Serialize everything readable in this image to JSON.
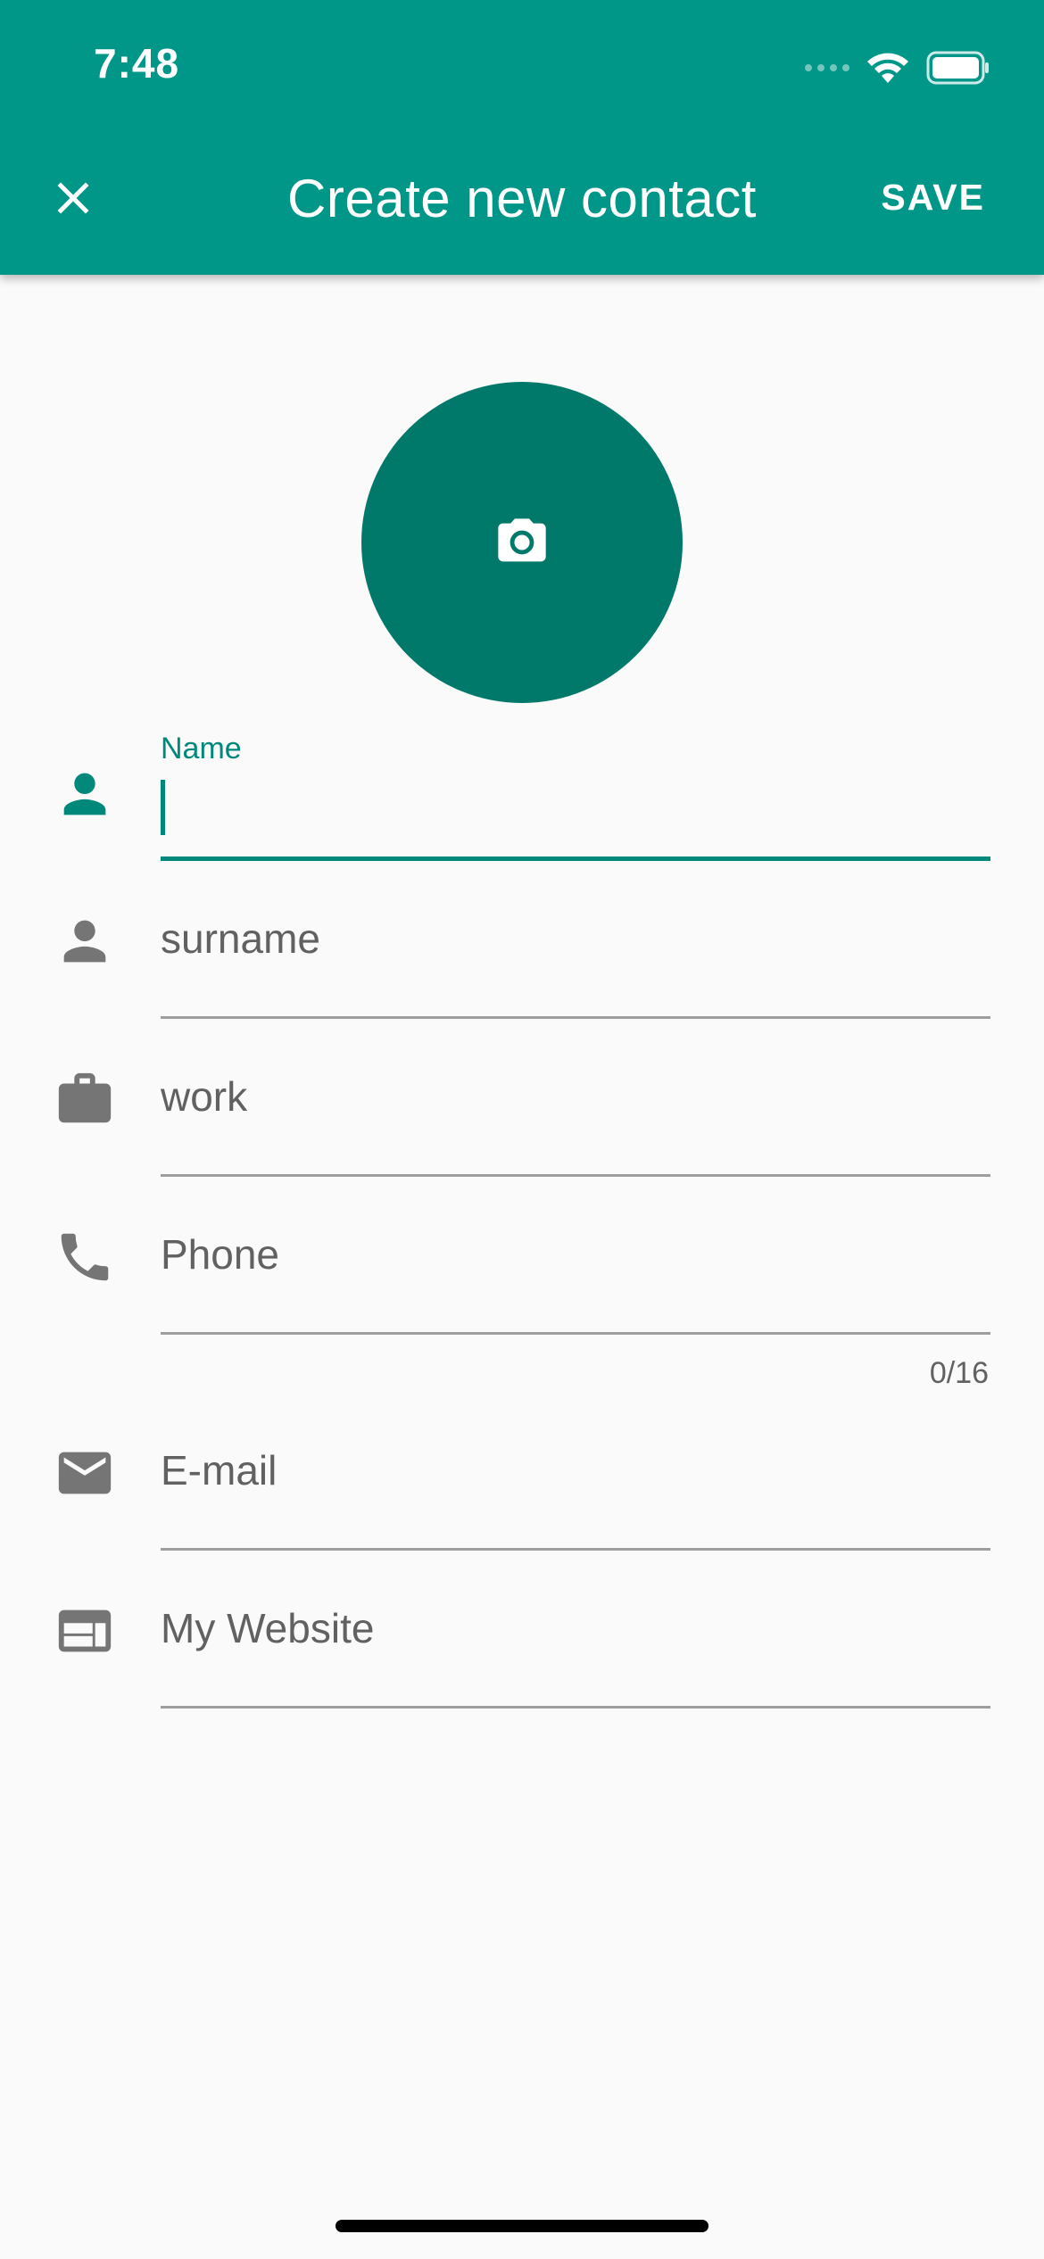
{
  "status_bar": {
    "time": "7:48"
  },
  "app_bar": {
    "title": "Create new contact",
    "save_label": "SAVE",
    "close_icon": "close-icon"
  },
  "avatar": {
    "icon": "camera-icon"
  },
  "form": {
    "name": {
      "label": "Name",
      "value": ""
    },
    "surname": {
      "placeholder": "surname"
    },
    "work": {
      "placeholder": "work"
    },
    "phone": {
      "placeholder": "Phone",
      "counter": "0/16"
    },
    "email": {
      "placeholder": "E-mail"
    },
    "website": {
      "placeholder": "My Website"
    }
  },
  "colors": {
    "primary": "#009688",
    "avatar": "#00796b",
    "accent": "#00897b",
    "icon_gray": "#757575",
    "background": "#fafafa"
  }
}
